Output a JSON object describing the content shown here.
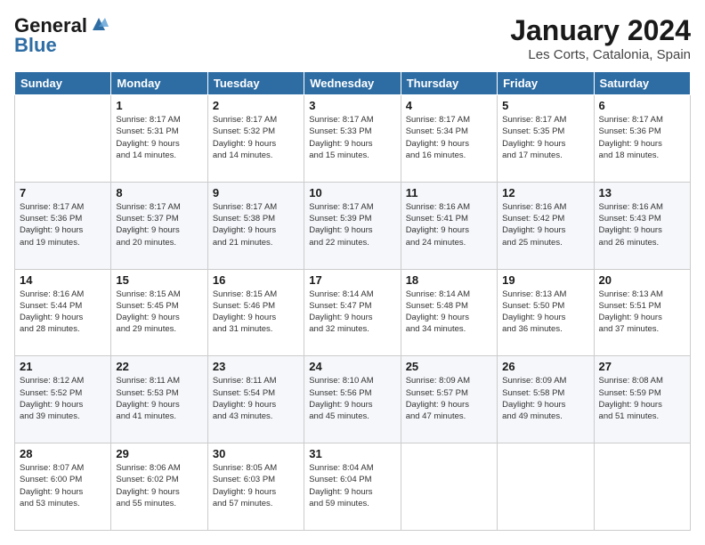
{
  "header": {
    "logo": {
      "line1": "General",
      "line2": "Blue"
    },
    "month": "January 2024",
    "location": "Les Corts, Catalonia, Spain"
  },
  "weekdays": [
    "Sunday",
    "Monday",
    "Tuesday",
    "Wednesday",
    "Thursday",
    "Friday",
    "Saturday"
  ],
  "weeks": [
    [
      {
        "day": "",
        "info": ""
      },
      {
        "day": "1",
        "info": "Sunrise: 8:17 AM\nSunset: 5:31 PM\nDaylight: 9 hours\nand 14 minutes."
      },
      {
        "day": "2",
        "info": "Sunrise: 8:17 AM\nSunset: 5:32 PM\nDaylight: 9 hours\nand 14 minutes."
      },
      {
        "day": "3",
        "info": "Sunrise: 8:17 AM\nSunset: 5:33 PM\nDaylight: 9 hours\nand 15 minutes."
      },
      {
        "day": "4",
        "info": "Sunrise: 8:17 AM\nSunset: 5:34 PM\nDaylight: 9 hours\nand 16 minutes."
      },
      {
        "day": "5",
        "info": "Sunrise: 8:17 AM\nSunset: 5:35 PM\nDaylight: 9 hours\nand 17 minutes."
      },
      {
        "day": "6",
        "info": "Sunrise: 8:17 AM\nSunset: 5:36 PM\nDaylight: 9 hours\nand 18 minutes."
      }
    ],
    [
      {
        "day": "7",
        "info": "Sunrise: 8:17 AM\nSunset: 5:36 PM\nDaylight: 9 hours\nand 19 minutes."
      },
      {
        "day": "8",
        "info": "Sunrise: 8:17 AM\nSunset: 5:37 PM\nDaylight: 9 hours\nand 20 minutes."
      },
      {
        "day": "9",
        "info": "Sunrise: 8:17 AM\nSunset: 5:38 PM\nDaylight: 9 hours\nand 21 minutes."
      },
      {
        "day": "10",
        "info": "Sunrise: 8:17 AM\nSunset: 5:39 PM\nDaylight: 9 hours\nand 22 minutes."
      },
      {
        "day": "11",
        "info": "Sunrise: 8:16 AM\nSunset: 5:41 PM\nDaylight: 9 hours\nand 24 minutes."
      },
      {
        "day": "12",
        "info": "Sunrise: 8:16 AM\nSunset: 5:42 PM\nDaylight: 9 hours\nand 25 minutes."
      },
      {
        "day": "13",
        "info": "Sunrise: 8:16 AM\nSunset: 5:43 PM\nDaylight: 9 hours\nand 26 minutes."
      }
    ],
    [
      {
        "day": "14",
        "info": "Sunrise: 8:16 AM\nSunset: 5:44 PM\nDaylight: 9 hours\nand 28 minutes."
      },
      {
        "day": "15",
        "info": "Sunrise: 8:15 AM\nSunset: 5:45 PM\nDaylight: 9 hours\nand 29 minutes."
      },
      {
        "day": "16",
        "info": "Sunrise: 8:15 AM\nSunset: 5:46 PM\nDaylight: 9 hours\nand 31 minutes."
      },
      {
        "day": "17",
        "info": "Sunrise: 8:14 AM\nSunset: 5:47 PM\nDaylight: 9 hours\nand 32 minutes."
      },
      {
        "day": "18",
        "info": "Sunrise: 8:14 AM\nSunset: 5:48 PM\nDaylight: 9 hours\nand 34 minutes."
      },
      {
        "day": "19",
        "info": "Sunrise: 8:13 AM\nSunset: 5:50 PM\nDaylight: 9 hours\nand 36 minutes."
      },
      {
        "day": "20",
        "info": "Sunrise: 8:13 AM\nSunset: 5:51 PM\nDaylight: 9 hours\nand 37 minutes."
      }
    ],
    [
      {
        "day": "21",
        "info": "Sunrise: 8:12 AM\nSunset: 5:52 PM\nDaylight: 9 hours\nand 39 minutes."
      },
      {
        "day": "22",
        "info": "Sunrise: 8:11 AM\nSunset: 5:53 PM\nDaylight: 9 hours\nand 41 minutes."
      },
      {
        "day": "23",
        "info": "Sunrise: 8:11 AM\nSunset: 5:54 PM\nDaylight: 9 hours\nand 43 minutes."
      },
      {
        "day": "24",
        "info": "Sunrise: 8:10 AM\nSunset: 5:56 PM\nDaylight: 9 hours\nand 45 minutes."
      },
      {
        "day": "25",
        "info": "Sunrise: 8:09 AM\nSunset: 5:57 PM\nDaylight: 9 hours\nand 47 minutes."
      },
      {
        "day": "26",
        "info": "Sunrise: 8:09 AM\nSunset: 5:58 PM\nDaylight: 9 hours\nand 49 minutes."
      },
      {
        "day": "27",
        "info": "Sunrise: 8:08 AM\nSunset: 5:59 PM\nDaylight: 9 hours\nand 51 minutes."
      }
    ],
    [
      {
        "day": "28",
        "info": "Sunrise: 8:07 AM\nSunset: 6:00 PM\nDaylight: 9 hours\nand 53 minutes."
      },
      {
        "day": "29",
        "info": "Sunrise: 8:06 AM\nSunset: 6:02 PM\nDaylight: 9 hours\nand 55 minutes."
      },
      {
        "day": "30",
        "info": "Sunrise: 8:05 AM\nSunset: 6:03 PM\nDaylight: 9 hours\nand 57 minutes."
      },
      {
        "day": "31",
        "info": "Sunrise: 8:04 AM\nSunset: 6:04 PM\nDaylight: 9 hours\nand 59 minutes."
      },
      {
        "day": "",
        "info": ""
      },
      {
        "day": "",
        "info": ""
      },
      {
        "day": "",
        "info": ""
      }
    ]
  ]
}
